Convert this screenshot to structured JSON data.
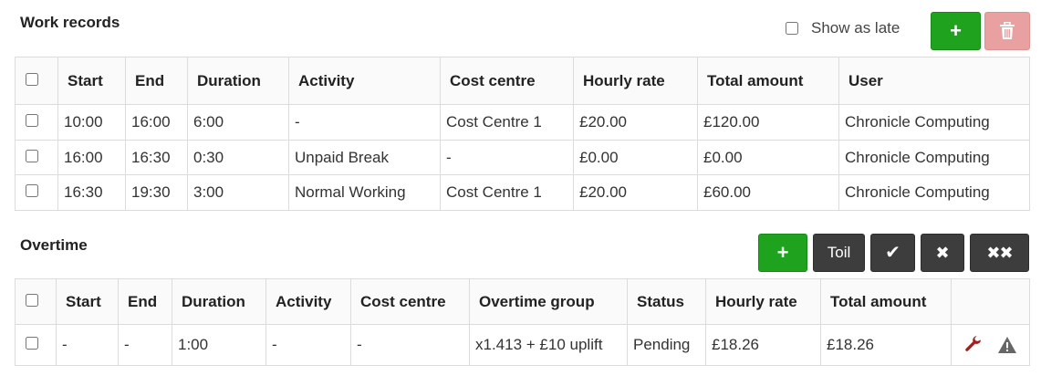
{
  "work_records": {
    "title": "Work records",
    "show_as_late_label": "Show as late",
    "add_button_glyph": "+",
    "delete_button_icon": "trash-icon",
    "headers": [
      "Start",
      "End",
      "Duration",
      "Activity",
      "Cost centre",
      "Hourly rate",
      "Total amount",
      "User"
    ],
    "rows": [
      {
        "start": "10:00",
        "end": "16:00",
        "duration": "6:00",
        "activity": "-",
        "cost_centre": "Cost Centre 1",
        "hourly_rate": "£20.00",
        "total_amount": "£120.00",
        "user": "Chronicle Computing"
      },
      {
        "start": "16:00",
        "end": "16:30",
        "duration": "0:30",
        "activity": "Unpaid Break",
        "cost_centre": "-",
        "hourly_rate": "£0.00",
        "total_amount": "£0.00",
        "user": "Chronicle Computing"
      },
      {
        "start": "16:30",
        "end": "19:30",
        "duration": "3:00",
        "activity": "Normal Working",
        "cost_centre": "Cost Centre 1",
        "hourly_rate": "£20.00",
        "total_amount": "£60.00",
        "user": "Chronicle Computing"
      }
    ]
  },
  "overtime": {
    "title": "Overtime",
    "add_button_glyph": "+",
    "toil_label": "Toil",
    "approve_glyph": "✔",
    "reject_glyph": "✖",
    "reject_all_glyph": "✖✖",
    "headers": [
      "Start",
      "End",
      "Duration",
      "Activity",
      "Cost centre",
      "Overtime group",
      "Status",
      "Hourly rate",
      "Total amount"
    ],
    "rows": [
      {
        "start": "-",
        "end": "-",
        "duration": "1:00",
        "activity": "-",
        "cost_centre": "-",
        "overtime_group": "x1.413 + £10 uplift",
        "status": "Pending",
        "hourly_rate": "£18.26",
        "total_amount": "£18.26"
      }
    ]
  },
  "icons": {
    "wrench": "wrench-icon",
    "warning": "warning-icon"
  },
  "colors": {
    "green": "#1fa31f",
    "danger_disabled": "#e8a0a0",
    "dark_button": "#3d3d3d",
    "wrench": "#a02020"
  }
}
